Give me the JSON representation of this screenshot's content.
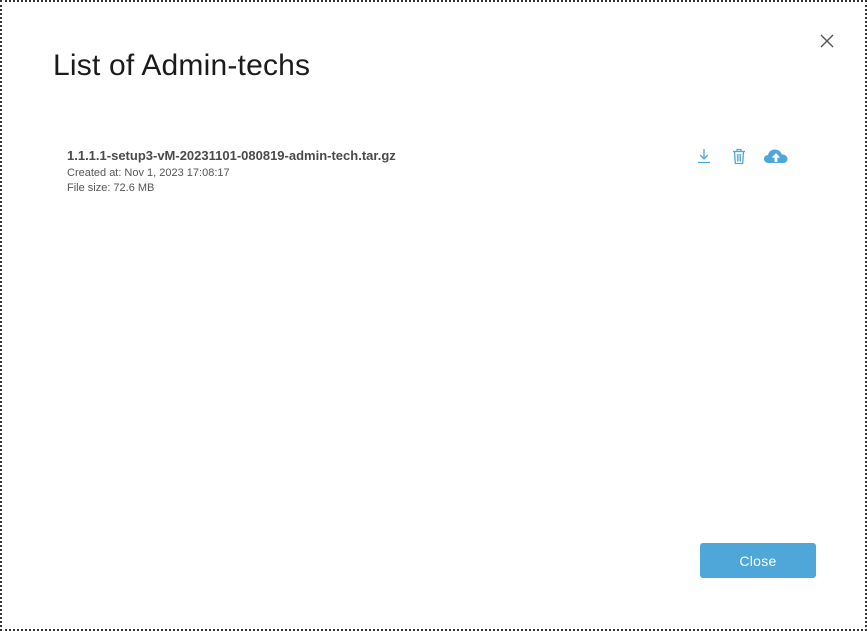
{
  "dialog": {
    "title": "List of Admin-techs",
    "close_icon": "close-icon"
  },
  "files": [
    {
      "name": "1.1.1.1-setup3-vM-20231101-080819-admin-tech.tar.gz",
      "created_label": "Created at:",
      "created_value": "Nov 1, 2023 17:08:17",
      "size_label": "File size:",
      "size_value": "72.6 MB",
      "actions": {
        "download_icon": "download-icon",
        "delete_icon": "trash-icon",
        "upload_icon": "cloud-upload-icon"
      }
    }
  ],
  "footer": {
    "close_label": "Close"
  },
  "colors": {
    "accent": "#4ea6d9",
    "title_text": "#1b1b1b",
    "secondary_text": "#555555"
  }
}
